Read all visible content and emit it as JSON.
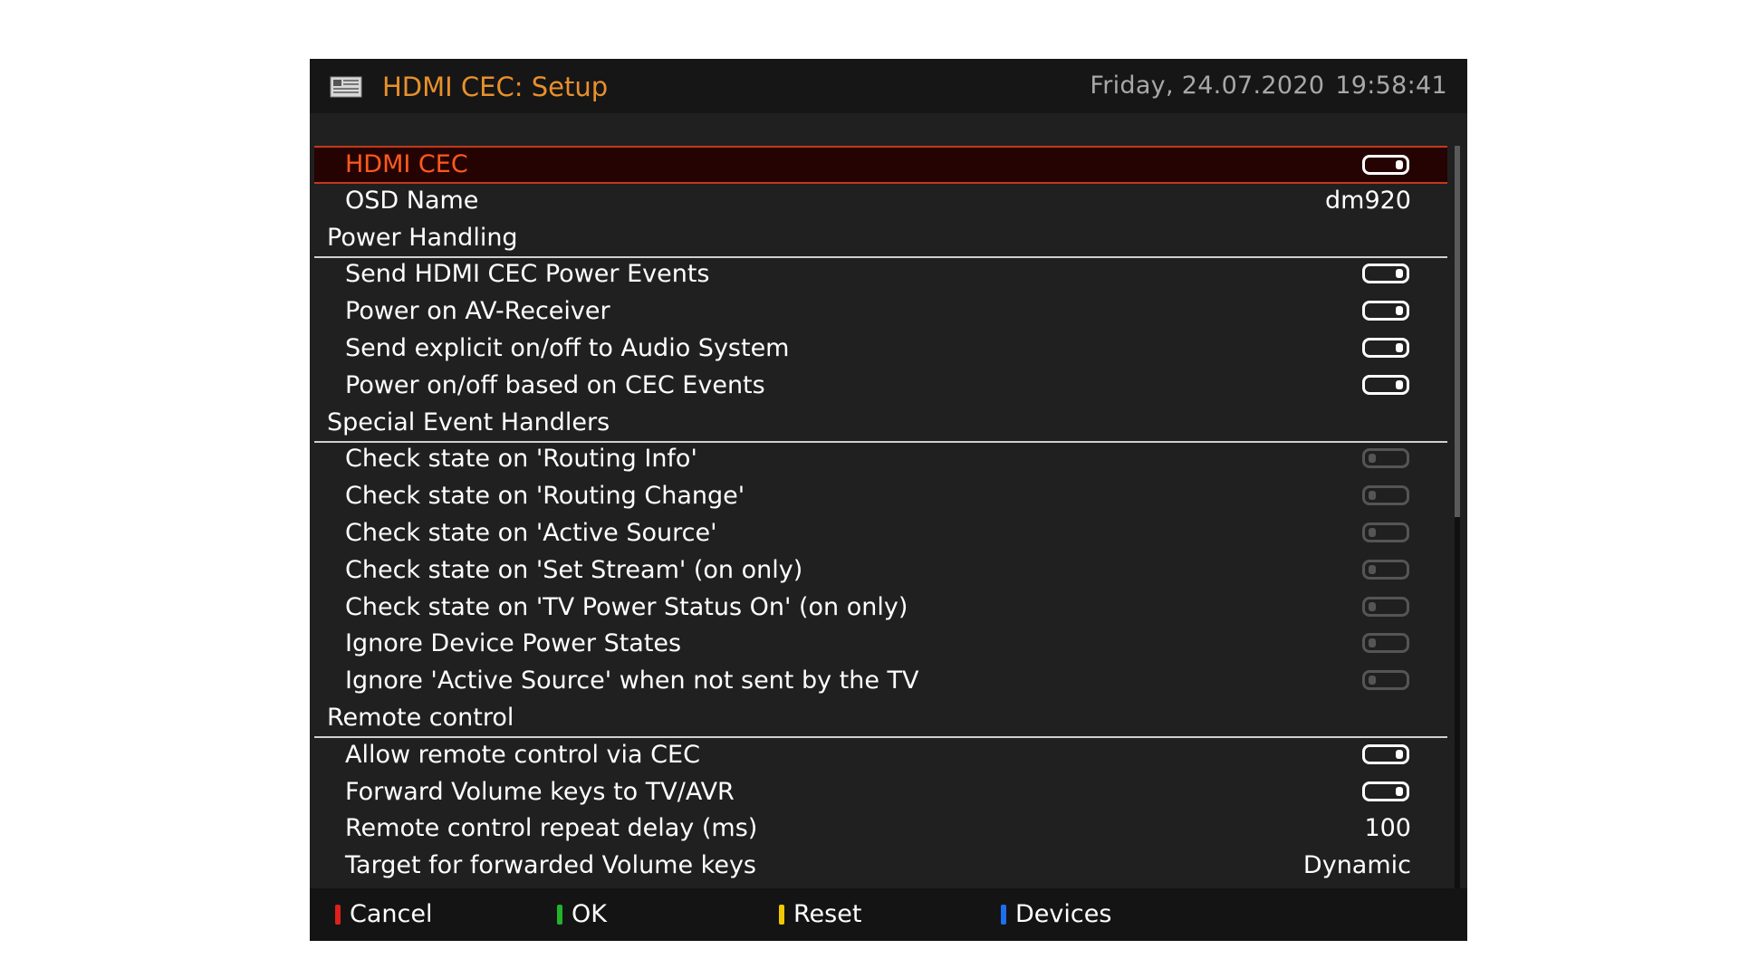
{
  "header": {
    "icon": "setup-panel-icon",
    "title": "HDMI CEC: Setup",
    "date": "Friday, 24.07.2020",
    "time": "19:58:41"
  },
  "list": [
    {
      "type": "item",
      "label": "HDMI CEC",
      "toggle": "on",
      "selected": true
    },
    {
      "type": "item",
      "label": "OSD Name",
      "value": "dm920"
    },
    {
      "type": "section",
      "label": "Power Handling"
    },
    {
      "type": "item",
      "label": "Send HDMI CEC Power Events",
      "toggle": "on"
    },
    {
      "type": "item",
      "label": "Power on AV-Receiver",
      "toggle": "on"
    },
    {
      "type": "item",
      "label": "Send explicit on/off to Audio System",
      "toggle": "on"
    },
    {
      "type": "item",
      "label": "Power on/off based on CEC Events",
      "toggle": "on"
    },
    {
      "type": "section",
      "label": "Special Event Handlers"
    },
    {
      "type": "item",
      "label": "Check state on 'Routing Info'",
      "toggle": "off"
    },
    {
      "type": "item",
      "label": "Check state on 'Routing Change'",
      "toggle": "off"
    },
    {
      "type": "item",
      "label": "Check state on 'Active Source'",
      "toggle": "off"
    },
    {
      "type": "item",
      "label": "Check state on 'Set Stream' (on only)",
      "toggle": "off"
    },
    {
      "type": "item",
      "label": "Check state on 'TV Power Status On' (on only)",
      "toggle": "off"
    },
    {
      "type": "item",
      "label": "Ignore Device Power States",
      "toggle": "off"
    },
    {
      "type": "item",
      "label": "Ignore 'Active Source' when not sent by the TV",
      "toggle": "off"
    },
    {
      "type": "section",
      "label": "Remote control"
    },
    {
      "type": "item",
      "label": "Allow remote control via CEC",
      "toggle": "on"
    },
    {
      "type": "item",
      "label": "Forward Volume keys to TV/AVR",
      "toggle": "on"
    },
    {
      "type": "item",
      "label": "Remote control repeat delay (ms)",
      "value": "100"
    },
    {
      "type": "item",
      "label": "Target for forwarded Volume keys",
      "value": "Dynamic"
    }
  ],
  "scroll_fraction": 0.5,
  "footer": {
    "buttons": [
      {
        "key": "red",
        "label": "Cancel",
        "color": "#e0201c"
      },
      {
        "key": "green",
        "label": "OK",
        "color": "#22b32a"
      },
      {
        "key": "yellow",
        "label": "Reset",
        "color": "#f0c800"
      },
      {
        "key": "blue",
        "label": "Devices",
        "color": "#1e6ef0"
      }
    ]
  },
  "colors": {
    "accent": "#e8902c",
    "selection_border": "#c23a1c",
    "selection_text": "#ff5a1e"
  }
}
